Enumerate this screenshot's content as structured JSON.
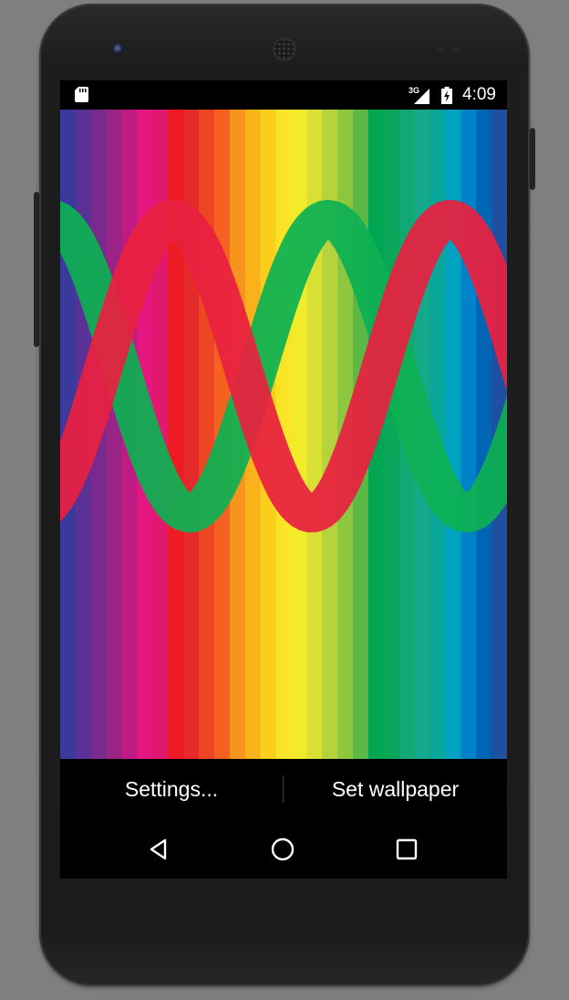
{
  "status_bar": {
    "network_type": "3G",
    "time": "4:09",
    "icons": [
      "sd-card-icon",
      "signal-icon",
      "battery-charging-icon"
    ]
  },
  "wallpaper": {
    "stripe_colors": [
      "#3a3a9c",
      "#5a3296",
      "#7a2a8c",
      "#9a2486",
      "#c01a84",
      "#e3177f",
      "#e0186e",
      "#ed1c24",
      "#e42a2a",
      "#ee4623",
      "#f5611e",
      "#f7941d",
      "#f9b21a",
      "#fbce1d",
      "#f9e425",
      "#f2eb2a",
      "#d9e034",
      "#b6d23d",
      "#8dc63f",
      "#5cb946",
      "#00a651",
      "#0aa65a",
      "#12a873",
      "#14a98a",
      "#0aa69a",
      "#00a2c2",
      "#0082c8",
      "#0066b3",
      "#1e4fa0"
    ],
    "waves": [
      {
        "name": "red-wave",
        "color": "#e8203f"
      },
      {
        "name": "green-wave",
        "color": "#0db053"
      }
    ]
  },
  "action_bar": {
    "settings_label": "Settings...",
    "set_wallpaper_label": "Set wallpaper"
  },
  "nav_bar": {
    "icons": [
      "back-icon",
      "home-icon",
      "recents-icon"
    ]
  }
}
